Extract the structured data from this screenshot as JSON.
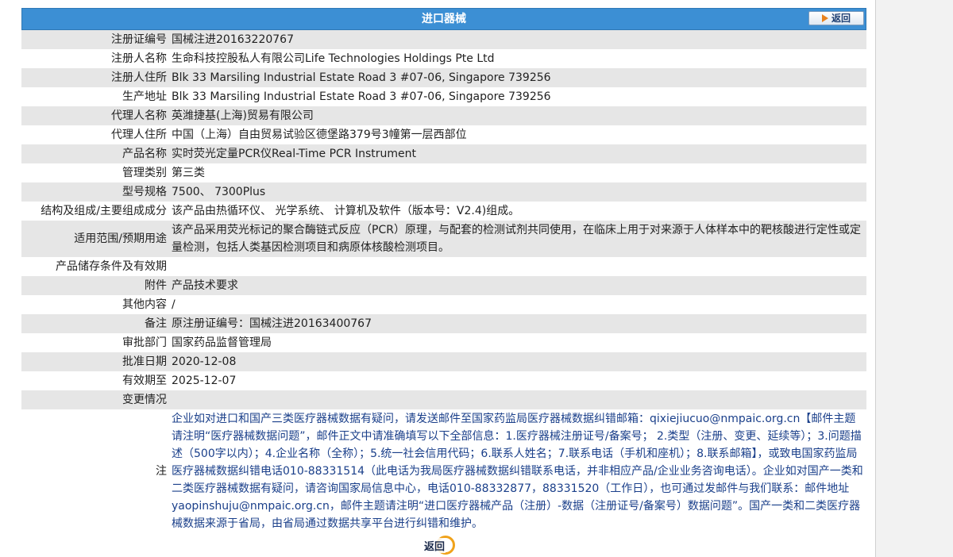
{
  "header": {
    "title": "进口器械",
    "back_label": "返回"
  },
  "fields": [
    {
      "label": "注册证编号",
      "value": "国械注进20163220767"
    },
    {
      "label": "注册人名称",
      "value": "生命科技控股私人有限公司Life Technologies Holdings Pte Ltd"
    },
    {
      "label": "注册人住所",
      "value": "Blk 33 Marsiling Industrial Estate Road 3 #07-06, Singapore 739256"
    },
    {
      "label": "生产地址",
      "value": "Blk 33 Marsiling Industrial Estate Road 3 #07-06, Singapore 739256"
    },
    {
      "label": "代理人名称",
      "value": "英潍捷基(上海)贸易有限公司"
    },
    {
      "label": "代理人住所",
      "value": "中国（上海）自由贸易试验区德堡路379号3幢第一层西部位"
    },
    {
      "label": "产品名称",
      "value": "实时荧光定量PCR仪Real-Time PCR Instrument"
    },
    {
      "label": "管理类别",
      "value": "第三类"
    },
    {
      "label": "型号规格",
      "value": "7500、 7300Plus"
    },
    {
      "label": "结构及组成/主要组成成分",
      "value": "该产品由热循环仪、 光学系统、 计算机及软件（版本号：V2.4)组成。"
    },
    {
      "label": "适用范围/预期用途",
      "value": "该产品采用荧光标记的聚合酶链式反应（PCR）原理，与配套的检测试剂共同使用，在临床上用于对来源于人体样本中的靶核酸进行定性或定量检测，包括人类基因检测项目和病原体核酸检测项目。"
    },
    {
      "label": "产品储存条件及有效期",
      "value": ""
    },
    {
      "label": "附件",
      "value": "产品技术要求"
    },
    {
      "label": "其他内容",
      "value": "/"
    },
    {
      "label": "备注",
      "value": "原注册证编号：国械注进20163400767"
    },
    {
      "label": "审批部门",
      "value": "国家药品监督管理局"
    },
    {
      "label": "批准日期",
      "value": "2020-12-08"
    },
    {
      "label": "有效期至",
      "value": "2025-12-07"
    },
    {
      "label": "变更情况",
      "value": ""
    }
  ],
  "note": {
    "label": "注",
    "text": "企业如对进口和国产三类医疗器械数据有疑问，请发送邮件至国家药监局医疗器械数据纠错邮箱：qixiejiucuo@nmpaic.org.cn【邮件主题请注明“医疗器械数据问题”，邮件正文中请准确填写以下全部信息：1.医疗器械注册证号/备案号； 2.类型（注册、变更、延续等）；3.问题描述（500字以内）；4.企业名称（全称）；5.统一社会信用代码；6.联系人姓名；7.联系电话（手机和座机）；8.联系邮箱】，或致电国家药监局医疗器械数据纠错电话010-88331514（此电话为我局医疗器械数据纠错联系电话，并非相应产品/企业业务咨询电话）。企业如对国产一类和二类医疗器械数据有疑问，请咨询国家局信息中心，电话010-88332877，88331520（工作日），也可通过发邮件与我们联系：邮件地址yaopinshuju@nmpaic.org.cn，邮件主题请注明“进口医疗器械产品（注册）-数据（注册证号/备案号）数据问题”。国产一类和二类医疗器械数据来源于省局，由省局通过数据共享平台进行纠错和维护。"
  },
  "footer": {
    "back_label": "返回"
  },
  "colors": {
    "title_bar": "#3c8fd4",
    "row_alt": "#e6e6e6",
    "note_text": "#1a3f8a",
    "back_ring": "#f0a21a"
  }
}
